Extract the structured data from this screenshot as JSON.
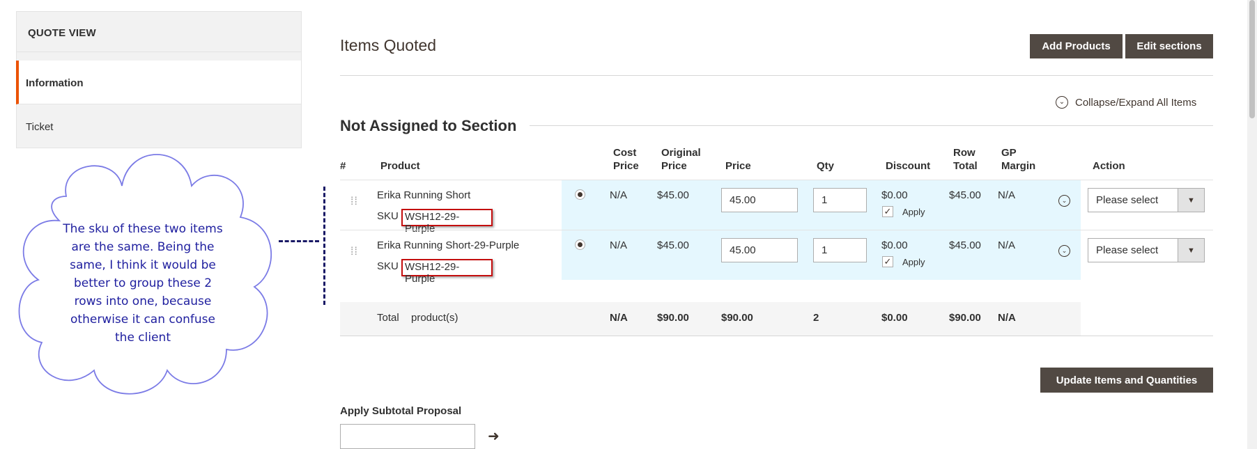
{
  "sidebar": {
    "title": "QUOTE VIEW",
    "items": [
      {
        "label": "Information"
      },
      {
        "label": "Ticket"
      }
    ]
  },
  "annotation": {
    "text": "The sku of these two items are the same. Being the same, I think it would be better to group these 2 rows into one, because otherwise it can confuse the client"
  },
  "header": {
    "title": "Items Quoted",
    "add_products": "Add Products",
    "edit_sections": "Edit sections",
    "collapse_all": "Collapse/Expand All Items"
  },
  "section": {
    "title": "Not Assigned to Section"
  },
  "table": {
    "headers": {
      "num": "#",
      "product": "Product",
      "cost_price_1": "Cost",
      "cost_price_2": "Price",
      "original_price_1": "Original",
      "original_price_2": "Price",
      "price": "Price",
      "qty": "Qty",
      "discount": "Discount",
      "row_total_1": "Row",
      "row_total_2": "Total",
      "gp_margin_1": "GP",
      "gp_margin_2": "Margin",
      "action": "Action"
    },
    "rows": [
      {
        "name": "Erika Running Short",
        "sku_label": "SKU :",
        "sku": "WSH12-29-Purple",
        "cost_price": "N/A",
        "original_price": "$45.00",
        "price": "45.00",
        "qty": "1",
        "discount": "$0.00",
        "apply": "Apply",
        "row_total": "$45.00",
        "gp_margin": "N/A",
        "action": "Please select"
      },
      {
        "name": "Erika Running Short-29-Purple",
        "sku_label": "SKU",
        "sku": "WSH12-29-Purple",
        "cost_price": "N/A",
        "original_price": "$45.00",
        "price": "45.00",
        "qty": "1",
        "discount": "$0.00",
        "apply": "Apply",
        "row_total": "$45.00",
        "gp_margin": "N/A",
        "action": "Please select"
      }
    ],
    "totals": {
      "label": "Total",
      "products": "product(s)",
      "cost_price": "N/A",
      "original_price": "$90.00",
      "price": "$90.00",
      "qty": "2",
      "discount": "$0.00",
      "row_total": "$90.00",
      "gp_margin": "N/A"
    }
  },
  "footer": {
    "update_button": "Update Items and Quantities",
    "subtotal_label": "Apply Subtotal Proposal",
    "subtotal_value": ""
  },
  "colors": {
    "accent": "#eb5202",
    "button_dark": "#514943",
    "row_highlight": "#e5f7fe",
    "annotation_text": "#1f1f9f",
    "annotation_box": "#c40d0d"
  }
}
